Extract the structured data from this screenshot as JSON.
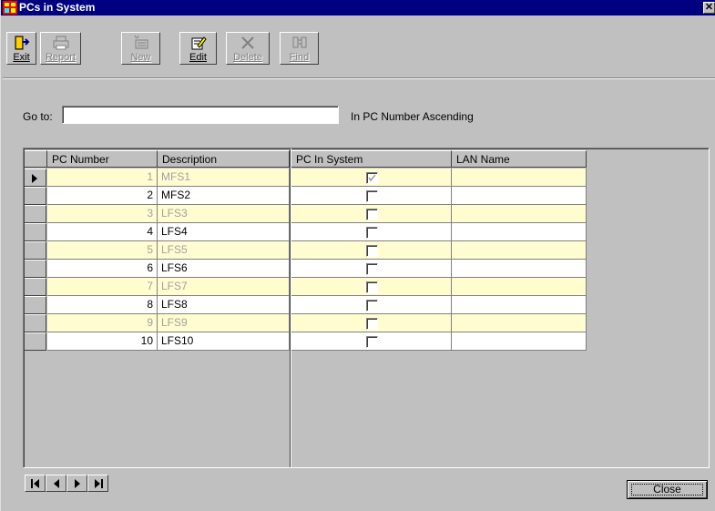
{
  "window": {
    "title": "PCs in System",
    "close_glyph": "✕"
  },
  "toolbar": {
    "buttons": [
      {
        "key": "exit",
        "label": "Exit",
        "icon": "exit-door-icon",
        "enabled": true
      },
      {
        "key": "report",
        "label": "Report",
        "icon": "printer-icon",
        "enabled": false
      },
      {
        "key": "new",
        "label": "New",
        "icon": "new-record-icon",
        "enabled": false
      },
      {
        "key": "edit",
        "label": "Edit",
        "icon": "edit-pencil-icon",
        "enabled": true
      },
      {
        "key": "delete",
        "label": "Delete",
        "icon": "delete-x-icon",
        "enabled": false
      },
      {
        "key": "find",
        "label": "Find",
        "icon": "binoculars-icon",
        "enabled": false
      }
    ]
  },
  "goto": {
    "label": "Go to:",
    "value": "",
    "sort_text": "In PC Number Ascending"
  },
  "grid": {
    "columns": [
      "PC Number",
      "Description",
      "PC In System",
      "LAN Name"
    ],
    "rows": [
      {
        "pc_number": "1",
        "description": "MFS1",
        "in_system": true,
        "lan_name": ""
      },
      {
        "pc_number": "2",
        "description": "MFS2",
        "in_system": false,
        "lan_name": ""
      },
      {
        "pc_number": "3",
        "description": "LFS3",
        "in_system": false,
        "lan_name": ""
      },
      {
        "pc_number": "4",
        "description": "LFS4",
        "in_system": false,
        "lan_name": ""
      },
      {
        "pc_number": "5",
        "description": "LFS5",
        "in_system": false,
        "lan_name": ""
      },
      {
        "pc_number": "6",
        "description": "LFS6",
        "in_system": false,
        "lan_name": ""
      },
      {
        "pc_number": "7",
        "description": "LFS7",
        "in_system": false,
        "lan_name": ""
      },
      {
        "pc_number": "8",
        "description": "LFS8",
        "in_system": false,
        "lan_name": ""
      },
      {
        "pc_number": "9",
        "description": "LFS9",
        "in_system": false,
        "lan_name": ""
      },
      {
        "pc_number": "10",
        "description": "LFS10",
        "in_system": false,
        "lan_name": ""
      }
    ],
    "current_row": 0
  },
  "navigator": {
    "buttons": [
      "first-record-icon",
      "prior-record-icon",
      "next-record-icon",
      "last-record-icon"
    ]
  },
  "footer": {
    "close_label": "Close"
  },
  "colors": {
    "title_bar": "#000080",
    "face": "#c0c0c0",
    "row_alt": "#fffdd0",
    "row_alt_text": "#a0a0a0"
  }
}
